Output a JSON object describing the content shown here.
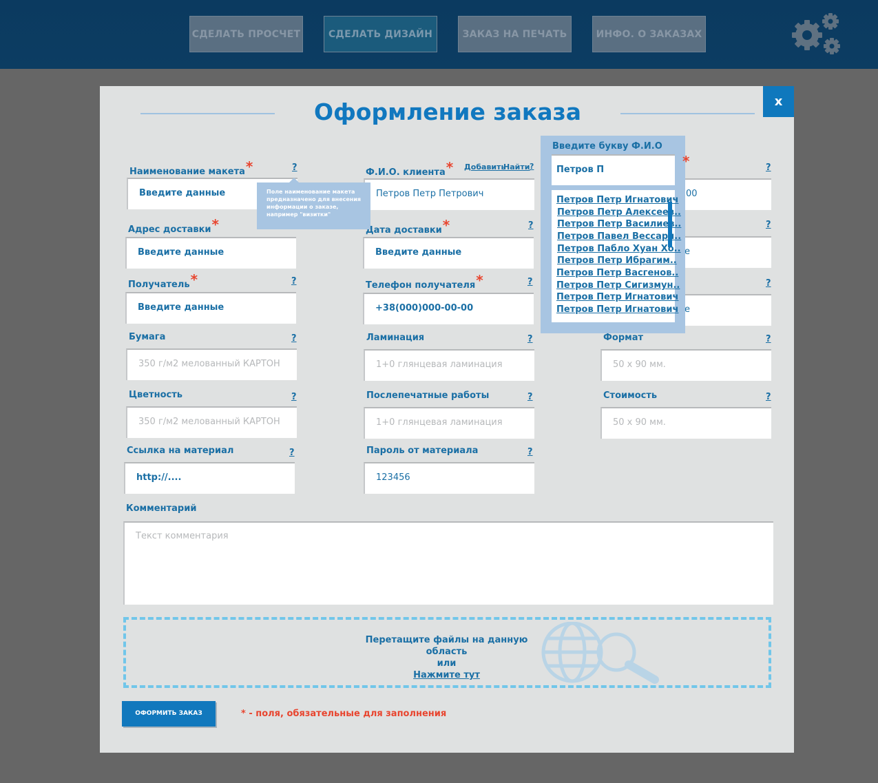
{
  "nav": {
    "items": [
      "СДЕЛАТЬ ПРОСЧЕТ",
      "СДЕЛАТЬ ДИЗАЙН",
      "ЗАКАЗ НА ПЕЧАТЬ",
      "ИНФО. О ЗАКАЗАХ"
    ],
    "active_index": 1,
    "settings_icon": "gears-icon"
  },
  "modal": {
    "title": "Оформление заказа",
    "close_label": "x"
  },
  "form": {
    "help_mark": "?",
    "name": {
      "label": "Наименование макета",
      "value": "Введите данные"
    },
    "tooltip": "Поле наименование макета предназначено для внесения информации о заказе, например \"визитки\"",
    "client": {
      "label": "Ф.И.О. клиента",
      "action_add": "Добавить",
      "action_find": "Найти",
      "value": "Петров Петр Петрович"
    },
    "col3_row1": {
      "value_tail": "00"
    },
    "address": {
      "label": "Адрес доставки",
      "value": "Введите данные"
    },
    "delivery_date": {
      "label": "Дата доставки",
      "value": "Введите данные"
    },
    "col3_row2": {
      "value_tail": "e"
    },
    "recipient": {
      "label": "Получатель",
      "value": "Введите данные"
    },
    "phone": {
      "label": "Телефон получателя",
      "value": "+38(000)000-00-00"
    },
    "col3_row3": {
      "value_tail": "e"
    },
    "paper": {
      "label": "Бумага",
      "placeholder": "350 г/м2 мелованный КАРТОН"
    },
    "lamination": {
      "label": "Ламинация",
      "placeholder": "1+0 глянцевая ламинация"
    },
    "format": {
      "label": "Формат",
      "placeholder": "50 х 90 мм."
    },
    "color": {
      "label": "Цветность",
      "placeholder": "350 г/м2 мелованный КАРТОН"
    },
    "postprint": {
      "label": "Послепечатные работы",
      "placeholder": "1+0 глянцевая ламинация"
    },
    "cost": {
      "label": "Стоимость",
      "placeholder": "50 х 90 мм."
    },
    "link": {
      "label": "Ссылка на материал",
      "value": "http://...."
    },
    "password": {
      "label": "Пароль от материала",
      "value": "123456"
    },
    "comment": {
      "label": "Комментарий",
      "placeholder": "Текст комментария"
    },
    "required_mark": "*"
  },
  "dropzone": {
    "line1": "Перетащите файлы на данную область",
    "line2": "или",
    "link": "Нажмите тут",
    "icon": "globe-search-icon"
  },
  "submit_label": "ОФОРМИТЬ ЗАКАЗ",
  "required_note": "* - поля, обязательные для заполнения",
  "client_search_popup": {
    "title": "Введите букву Ф.И.О",
    "query": "Петров П",
    "results": [
      "Петров Петр Игнатович",
      "Петров Петр Алексеев..",
      "Петров Петр Василиев..",
      "Петров Павел Вессари..",
      "Петров Пабло Хуан Хо..",
      "Петров Петр Ибрагим..",
      "Петров Петр Васгенов..",
      "Петров Петр Сигизмун..",
      "Петров Петр Игнатович",
      "Петров Петр Игнатович"
    ]
  },
  "colors": {
    "accent": "#1178bd",
    "topbar": "#0d3e63",
    "required": "#e8452f",
    "popup": "#a8c5e2",
    "dropzone_border": "#71c6ea"
  }
}
